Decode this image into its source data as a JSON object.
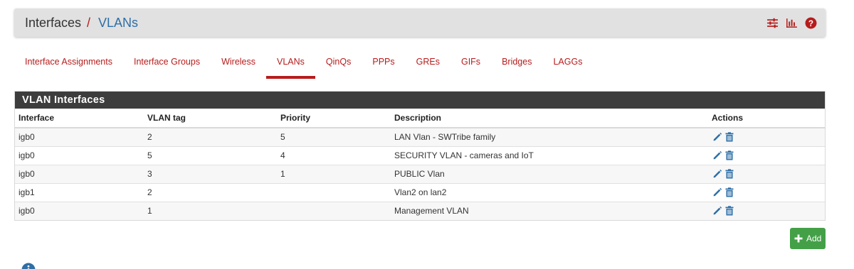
{
  "breadcrumb": {
    "parent": "Interfaces",
    "separator": "/",
    "current": "VLANs"
  },
  "header_icons": [
    "sliders-icon",
    "chart-icon",
    "help-icon"
  ],
  "tabs": [
    {
      "label": "Interface Assignments",
      "active": false
    },
    {
      "label": "Interface Groups",
      "active": false
    },
    {
      "label": "Wireless",
      "active": false
    },
    {
      "label": "VLANs",
      "active": true
    },
    {
      "label": "QinQs",
      "active": false
    },
    {
      "label": "PPPs",
      "active": false
    },
    {
      "label": "GREs",
      "active": false
    },
    {
      "label": "GIFs",
      "active": false
    },
    {
      "label": "Bridges",
      "active": false
    },
    {
      "label": "LAGGs",
      "active": false
    }
  ],
  "panel": {
    "title": "VLAN Interfaces",
    "columns": [
      "Interface",
      "VLAN tag",
      "Priority",
      "Description",
      "Actions"
    ],
    "rows": [
      {
        "interface": "igb0",
        "vlan_tag": "2",
        "priority": "5",
        "description": "LAN Vlan - SWTribe family"
      },
      {
        "interface": "igb0",
        "vlan_tag": "5",
        "priority": "4",
        "description": "SECURITY VLAN - cameras and IoT"
      },
      {
        "interface": "igb0",
        "vlan_tag": "3",
        "priority": "1",
        "description": "PUBLIC Vlan"
      },
      {
        "interface": "igb1",
        "vlan_tag": "2",
        "priority": "",
        "description": "Vlan2 on lan2"
      },
      {
        "interface": "igb0",
        "vlan_tag": "1",
        "priority": "",
        "description": "Management VLAN"
      }
    ]
  },
  "add_button": {
    "label": "Add"
  },
  "colors": {
    "accent_red": "#b71c1c",
    "link_blue": "#2e6fa7",
    "panel_header": "#3d3d3d",
    "add_green": "#43a047",
    "action_blue": "#2e6fa7"
  }
}
